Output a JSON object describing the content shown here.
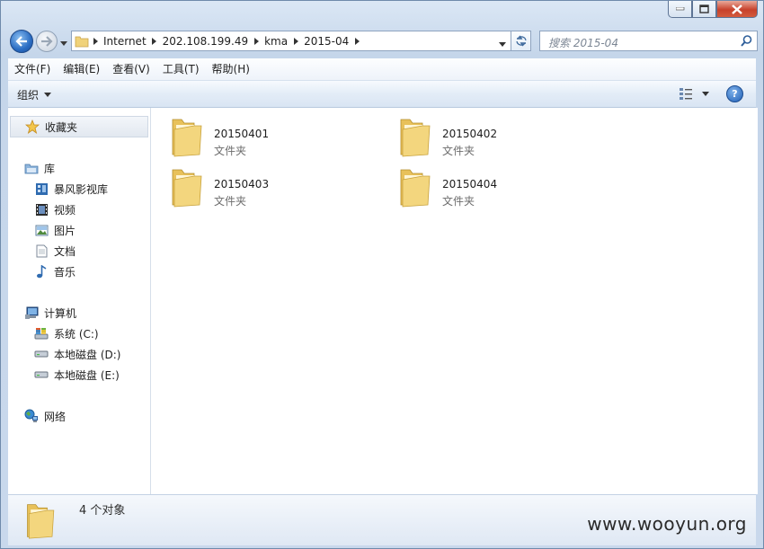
{
  "address": {
    "segments": [
      "Internet",
      "202.108.199.49",
      "kma",
      "2015-04"
    ]
  },
  "search": {
    "placeholder": "搜索 2015-04"
  },
  "menu": [
    "文件(F)",
    "编辑(E)",
    "查看(V)",
    "工具(T)",
    "帮助(H)"
  ],
  "toolbar": {
    "organize_label": "组织",
    "help_label": "?"
  },
  "nav": {
    "favorites": "收藏夹",
    "libraries": {
      "label": "库",
      "items": [
        "暴风影视库",
        "视频",
        "图片",
        "文档",
        "音乐"
      ]
    },
    "computer": {
      "label": "计算机",
      "items": [
        "系统 (C:)",
        "本地磁盘 (D:)",
        "本地磁盘 (E:)"
      ]
    },
    "network": "网络"
  },
  "folders": [
    {
      "name": "20150401",
      "type": "文件夹"
    },
    {
      "name": "20150402",
      "type": "文件夹"
    },
    {
      "name": "20150403",
      "type": "文件夹"
    },
    {
      "name": "20150404",
      "type": "文件夹"
    }
  ],
  "details": {
    "count": "4 个对象"
  },
  "watermark": "www.wooyun.org",
  "colors": {
    "accent": "#2a6cc2",
    "folder": "#f0d27a",
    "close": "#c7412b"
  }
}
